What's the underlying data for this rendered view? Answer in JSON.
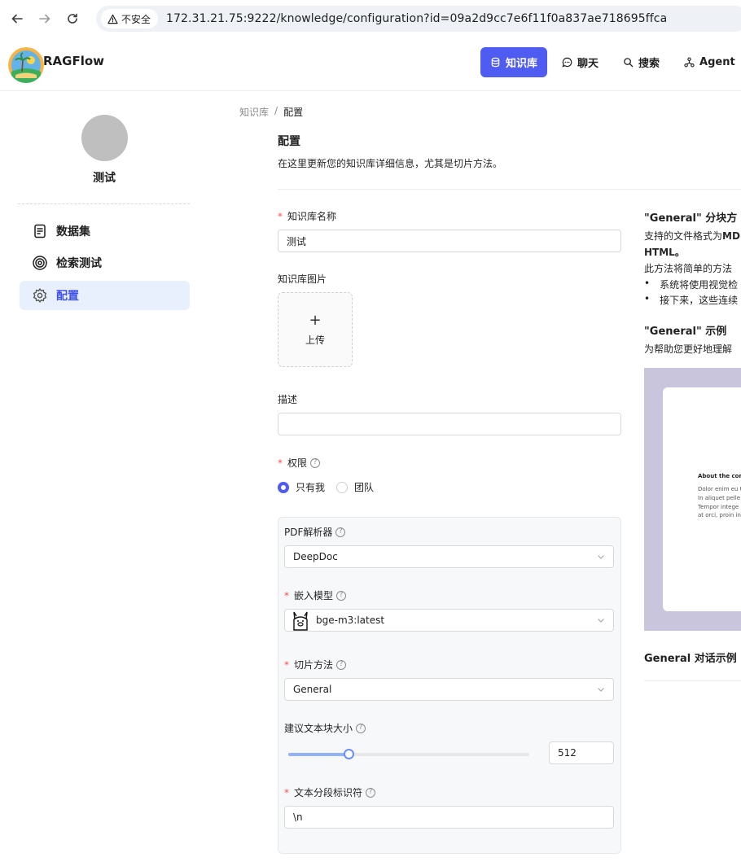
{
  "browser": {
    "insecure_label": "不安全",
    "url": "172.31.21.75:9222/knowledge/configuration?id=09a2d9cc7e6f11f0a837ae718695ffca"
  },
  "app": {
    "brand": "RAGFlow",
    "nav": [
      {
        "label": "知识库",
        "icon": "database-icon",
        "active": true
      },
      {
        "label": "聊天",
        "icon": "chat-icon",
        "active": false
      },
      {
        "label": "搜索",
        "icon": "search-icon",
        "active": false
      },
      {
        "label": "Agent",
        "icon": "agent-icon",
        "active": false
      }
    ],
    "accent_color": "#4e5cf2"
  },
  "sidebar": {
    "kb_name": "测试",
    "items": [
      {
        "label": "数据集",
        "icon": "document-icon",
        "active": false
      },
      {
        "label": "检索测试",
        "icon": "target-icon",
        "active": false
      },
      {
        "label": "配置",
        "icon": "gear-icon",
        "active": true
      }
    ]
  },
  "breadcrumb": {
    "root": "知识库",
    "separator": "/",
    "current": "配置"
  },
  "header": {
    "title": "配置",
    "description": "在这里更新您的知识库详细信息，尤其是切片方法。"
  },
  "form": {
    "name_label": "知识库名称",
    "name_value": "测试",
    "image_label": "知识库图片",
    "upload_label": "上传",
    "upload_plus": "+",
    "desc_label": "描述",
    "desc_value": "",
    "permission_label": "权限",
    "permission_options": [
      {
        "label": "只有我",
        "checked": true
      },
      {
        "label": "团队",
        "checked": false
      }
    ],
    "pdf_parser_label": "PDF解析器",
    "pdf_parser_value": "DeepDoc",
    "embedding_label": "嵌入模型",
    "embedding_value": "bge-m3:latest",
    "chunk_method_label": "切片方法",
    "chunk_method_value": "General",
    "chunk_size_label": "建议文本块大小",
    "chunk_size_value": "512",
    "chunk_size_slider_fraction": 0.25,
    "delimiter_label": "文本分段标识符",
    "delimiter_value": "\\n"
  },
  "right_panel": {
    "method_title": "\"General\" 分块方",
    "support_prefix": "支持的文件格式为",
    "support_bold": "MD",
    "support_line2": "HTML。",
    "method_desc": "此方法将简单的方法",
    "bullets": [
      "系统将使用视觉检",
      "接下来，这些连续"
    ],
    "bullet_char": "•",
    "example_title": "\"General\" 示例",
    "example_desc": "为帮助您更好地理解",
    "doc_lines": [
      "About the com",
      "Dolor enim eu t",
      "In aliquet pelle",
      "Tempor intege",
      "at orci, proin in"
    ],
    "chat_example_title": "General 对话示例"
  }
}
